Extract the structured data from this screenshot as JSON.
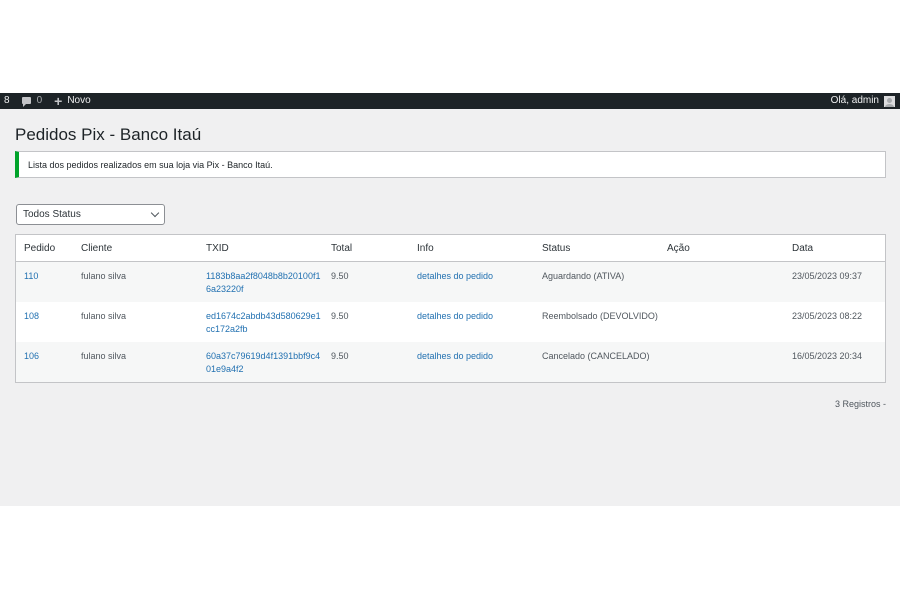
{
  "adminbar": {
    "site_fragment": "8",
    "comments_count": "0",
    "new_label": "Novo",
    "greeting": "Olá, admin"
  },
  "page": {
    "title": "Pedidos Pix - Banco Itaú",
    "notice": "Lista dos pedidos realizados em sua loja via Pix - Banco Itaú."
  },
  "filter": {
    "selected": "Todos Status"
  },
  "table": {
    "headers": [
      "Pedido",
      "Cliente",
      "TXID",
      "Total",
      "Info",
      "Status",
      "Ação",
      "Data"
    ],
    "rows": [
      {
        "pedido": "110",
        "cliente": "fulano silva",
        "txid": "1183b8aa2f8048b8b20100f16a23220f",
        "total": "9.50",
        "info": "detalhes do pedido",
        "status": "Aguardando (ATIVA)",
        "acao": "",
        "data": "23/05/2023 09:37"
      },
      {
        "pedido": "108",
        "cliente": "fulano silva",
        "txid": "ed1674c2abdb43d580629e1cc172a2fb",
        "total": "9.50",
        "info": "detalhes do pedido",
        "status": "Reembolsado (DEVOLVIDO)",
        "acao": "",
        "data": "23/05/2023 08:22"
      },
      {
        "pedido": "106",
        "cliente": "fulano silva",
        "txid": "60a37c79619d4f1391bbf9c401e9a4f2",
        "total": "9.50",
        "info": "detalhes do pedido",
        "status": "Cancelado (CANCELADO)",
        "acao": "",
        "data": "16/05/2023 20:34"
      }
    ]
  },
  "footer": {
    "records": "3 Registros -"
  }
}
